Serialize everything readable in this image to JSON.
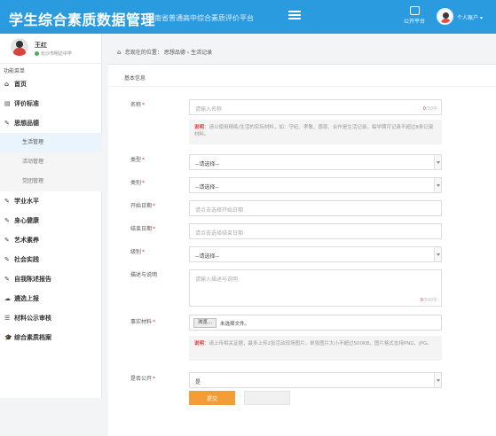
{
  "header": {
    "title": "学生综合素质数据管理",
    "subtitle": "湖南省普通高中综合素质评价平台",
    "platform_label": "公开平台",
    "user_label": "个人账户"
  },
  "sidebar": {
    "user_name": "王红",
    "user_status": "长沙市明达中学",
    "menu_title": "功能菜单",
    "items": [
      {
        "label": "首页",
        "icon": "home-icon",
        "glyph": "⌂"
      },
      {
        "label": "评价标准",
        "icon": "book-icon",
        "glyph": "▤"
      },
      {
        "label": "思想品德",
        "icon": "edit-icon",
        "glyph": "✎"
      },
      {
        "label": "生活管理",
        "sub": true,
        "active": true
      },
      {
        "label": "活动管理",
        "sub": true
      },
      {
        "label": "党团管理",
        "sub": true
      },
      {
        "label": "学业水平",
        "icon": "edit-icon",
        "glyph": "✎"
      },
      {
        "label": "身心健康",
        "icon": "edit-icon",
        "glyph": "✎"
      },
      {
        "label": "艺术素养",
        "icon": "edit-icon",
        "glyph": "✎"
      },
      {
        "label": "社会实践",
        "icon": "edit-icon",
        "glyph": "✎"
      },
      {
        "label": "自我陈述报告",
        "icon": "edit-icon",
        "glyph": "✎"
      },
      {
        "label": "遴选上报",
        "icon": "upload-icon",
        "glyph": "☁"
      },
      {
        "label": "材料公示审核",
        "icon": "list-icon",
        "glyph": "☰"
      },
      {
        "label": "综合素质档案",
        "icon": "graduation-cap-icon",
        "glyph": "🎓"
      }
    ]
  },
  "breadcrumb": {
    "prefix": "您现在的位置：",
    "parent": "思想品德",
    "separator": "›",
    "current": "生活记录"
  },
  "form": {
    "section_title": "基本信息",
    "name_label": "名称",
    "name_placeholder": "请输入名称",
    "name_counter_current": "0",
    "name_counter_max": "/30字",
    "note_keyword": "说明",
    "note_text": "：请以使用精练/生活的实际材料，如：守纪、孝敬、感恩、合作是生活记录。每学期可记录不超过8条记录材料。",
    "type_label": "类型",
    "type_value": "--请选择--",
    "category_label": "类别",
    "category_value": "--请选择--",
    "start_label": "开始日期",
    "start_placeholder": "请点击选择开始日期",
    "end_label": "结束日期",
    "end_placeholder": "请点击选择结束日期",
    "level_label": "级别",
    "level_value": "--请选择--",
    "desc_label": "描述与说明",
    "desc_placeholder": "请输入描述与说明",
    "desc_counter_current": "0",
    "desc_counter_max": "/500字",
    "material_label": "事实材料",
    "browse_label": "浏览...",
    "file_status": "未选择文件。",
    "material_note_keyword": "说明",
    "material_note_text": "：请上传相关证据，最多上传2张活动现场图片，单张图片大小不超过500KB，图片格式支持PNG、JPG。",
    "public_label": "是否公开",
    "public_value": "是",
    "submit_label": "提交",
    "reset_label": ""
  }
}
